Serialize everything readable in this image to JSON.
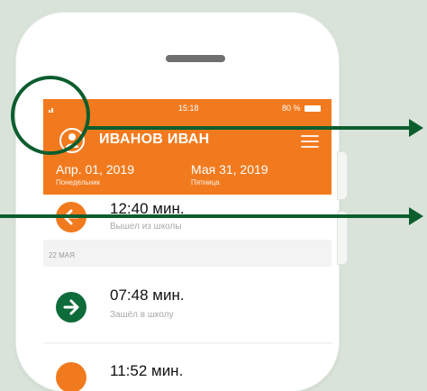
{
  "status_bar": {
    "time": "15:18",
    "battery": "80 %"
  },
  "header": {
    "user_name": "ИВАНОВ ИВАН",
    "date_from": "Апр. 01, 2019",
    "day_from": "Понедельник",
    "date_to": "Мая 31, 2019",
    "day_to": "Пятница"
  },
  "entries": [
    {
      "time": "12:40 мин.",
      "desc": "Вышел из школы",
      "direction": "out",
      "color": "#f27a1e"
    },
    {
      "time": "07:48 мин.",
      "desc": "Зашёл в школу",
      "direction": "in",
      "color": "#0e6b3a"
    },
    {
      "time": "11:52 мин.",
      "desc": "",
      "direction": "out",
      "color": "#f27a1e"
    }
  ],
  "day_separator": "22 МАЯ",
  "colors": {
    "accent": "#f27a1e",
    "enter": "#0e6b3a",
    "annotation": "#0c5d2e",
    "background": "#d9e3d9"
  }
}
